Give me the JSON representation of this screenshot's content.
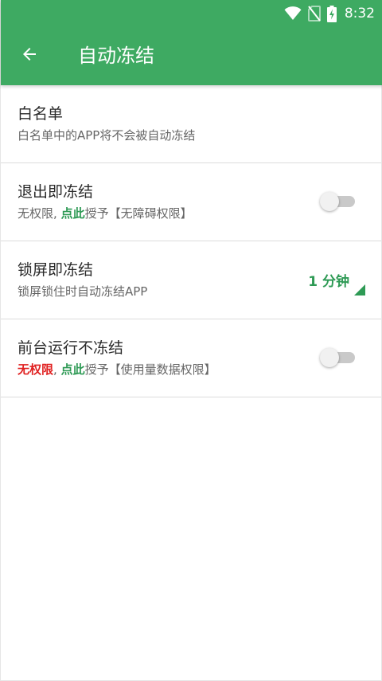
{
  "colors": {
    "app_bar": "#3eaa62",
    "accent_green": "#2e9a55",
    "accent_red": "#e02020"
  },
  "status_bar": {
    "time": "8:32",
    "icons": [
      "wifi-icon",
      "no-sim-icon",
      "battery-charging-icon"
    ]
  },
  "toolbar": {
    "back_icon": "arrow-back-icon",
    "title": "自动冻结"
  },
  "settings": [
    {
      "title": "白名单",
      "subtitle": "白名单中的APP将不会被自动冻结"
    },
    {
      "title": "退出即冻结",
      "subtitle_status": "无权限",
      "subtitle_separator": ", ",
      "subtitle_link": "点此",
      "subtitle_action": "授予【无障碍权限】",
      "switch_on": false
    },
    {
      "title": "锁屏即冻结",
      "subtitle": "锁屏锁住时自动冻结APP",
      "selected_value": "1 分钟"
    },
    {
      "title": "前台运行不冻结",
      "subtitle_status": "无权限",
      "subtitle_separator": ", ",
      "subtitle_link": "点此",
      "subtitle_action": "授予【使用量数据权限】",
      "switch_on": false
    }
  ]
}
